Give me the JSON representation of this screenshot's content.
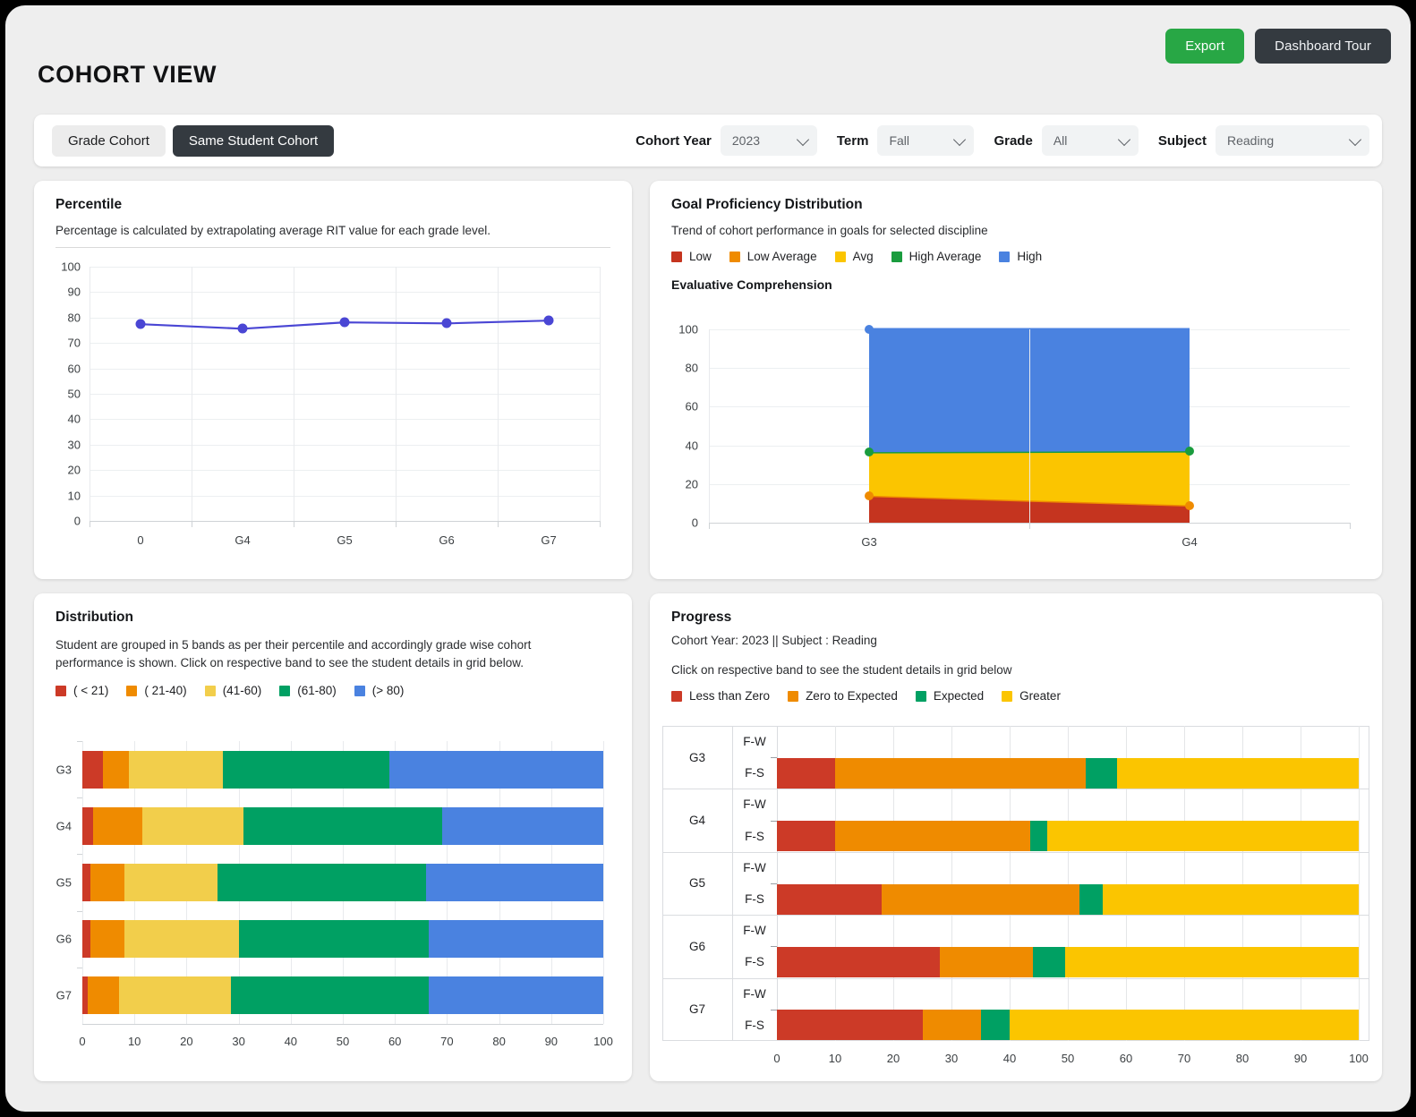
{
  "header": {
    "title": "COHORT VIEW",
    "export_label": "Export",
    "tour_label": "Dashboard Tour",
    "export_color": "#28a745",
    "tour_color": "#343a40"
  },
  "filterbar": {
    "toggle": [
      {
        "label": "Grade Cohort",
        "selected": false
      },
      {
        "label": "Same Student Cohort",
        "selected": true
      }
    ],
    "filters": [
      {
        "label": "Cohort Year",
        "value": "2023"
      },
      {
        "label": "Term",
        "value": "Fall"
      },
      {
        "label": "Grade",
        "value": "All"
      },
      {
        "label": "Subject",
        "value": "Reading"
      }
    ]
  },
  "percentile": {
    "title": "Percentile",
    "subtitle": "Percentage is calculated by extrapolating average RIT value for each grade level."
  },
  "goal": {
    "title": "Goal Proficiency Distribution",
    "subtitle": "Trend of cohort performance in goals for selected discipline",
    "section_title": "Evaluative Comprehension",
    "legend": [
      {
        "label": "Low",
        "color": "#c5341f"
      },
      {
        "label": "Low Average",
        "color": "#ef8b00"
      },
      {
        "label": "Avg",
        "color": "#fbc500"
      },
      {
        "label": "High Average",
        "color": "#1a9c3e"
      },
      {
        "label": "High",
        "color": "#4a82e0"
      }
    ]
  },
  "distribution": {
    "title": "Distribution",
    "subtitle": "Student are grouped in 5 bands as per their percentile and accordingly grade wise cohort performance is shown. Click on respective band to see the student details in grid below.",
    "legend": [
      {
        "label": "( < 21)",
        "color": "#cc3a27"
      },
      {
        "label": "( 21-40)",
        "color": "#ef8b00"
      },
      {
        "label": "(41-60)",
        "color": "#f2ce4b"
      },
      {
        "label": "(61-80)",
        "color": "#00a063"
      },
      {
        "label": "(> 80)",
        "color": "#4a82e0"
      }
    ]
  },
  "progress": {
    "title": "Progress",
    "subtitle": "Cohort Year: 2023 || Subject : Reading",
    "hint": "Click on respective band to see the student details in grid below",
    "legend": [
      {
        "label": "Less than Zero",
        "color": "#cc3a27"
      },
      {
        "label": "Zero to Expected",
        "color": "#ef8b00"
      },
      {
        "label": "Expected",
        "color": "#00a063"
      },
      {
        "label": "Greater",
        "color": "#fbc500"
      }
    ],
    "row_sublabels": [
      "F-W",
      "F-S"
    ]
  },
  "chart_data": [
    {
      "id": "percentile",
      "type": "line",
      "title": "Percentile",
      "xlabel": "",
      "ylabel": "",
      "categories": [
        "0",
        "G4",
        "G5",
        "G6",
        "G7"
      ],
      "series": [
        {
          "name": "Percentile",
          "color": "#4a46d4",
          "values": [
            77.4,
            75.6,
            78.1,
            77.7,
            78.8
          ]
        }
      ],
      "ylim": [
        0,
        100
      ],
      "yticks": [
        0,
        10,
        20,
        30,
        40,
        50,
        60,
        70,
        80,
        90,
        100
      ],
      "grid": true,
      "legend": "none"
    },
    {
      "id": "goal-proficiency",
      "type": "area",
      "title": "Evaluative Comprehension",
      "xlabel": "",
      "ylabel": "",
      "categories": [
        "G3",
        "G4"
      ],
      "series": [
        {
          "name": "Low",
          "color": "#c5341f",
          "values": [
            14.0,
            9.0
          ],
          "cumulative": [
            14.0,
            9.0
          ]
        },
        {
          "name": "Low Average",
          "color": "#ef8b00",
          "values": [
            0.0,
            0.0
          ],
          "cumulative": [
            14.0,
            9.0
          ]
        },
        {
          "name": "Avg",
          "color": "#fbc500",
          "values": [
            22.5,
            28.0
          ],
          "cumulative": [
            36.5,
            37.0
          ]
        },
        {
          "name": "High Average",
          "color": "#1a9c3e",
          "values": [
            0.0,
            0.0
          ],
          "cumulative": [
            36.5,
            37.0
          ]
        },
        {
          "name": "High",
          "color": "#4a82e0",
          "values": [
            63.5,
            63.0
          ],
          "cumulative": [
            100.0,
            100.0
          ]
        }
      ],
      "ylim": [
        0,
        100
      ],
      "yticks": [
        0,
        20,
        40,
        60,
        80,
        100
      ],
      "grid": true,
      "legend": "top"
    },
    {
      "id": "distribution",
      "type": "bar",
      "orientation": "horizontal",
      "stacked": true,
      "title": "Distribution",
      "categories": [
        "G3",
        "G4",
        "G5",
        "G6",
        "G7"
      ],
      "series": [
        {
          "name": "( < 21)",
          "color": "#cc3a27",
          "values": [
            4.0,
            2.0,
            1.5,
            1.5,
            1.0
          ]
        },
        {
          "name": "( 21-40)",
          "color": "#ef8b00",
          "values": [
            5.0,
            9.5,
            6.5,
            6.5,
            6.0
          ]
        },
        {
          "name": "(41-60)",
          "color": "#f2ce4b",
          "values": [
            18.0,
            19.5,
            18.0,
            22.0,
            21.5
          ]
        },
        {
          "name": "(61-80)",
          "color": "#00a063",
          "values": [
            32.0,
            38.0,
            40.0,
            36.5,
            38.0
          ]
        },
        {
          "name": "(> 80)",
          "color": "#4a82e0",
          "values": [
            41.0,
            31.0,
            34.0,
            33.5,
            33.5
          ]
        }
      ],
      "xlim": [
        0,
        100
      ],
      "xticks": [
        0,
        10,
        20,
        30,
        40,
        50,
        60,
        70,
        80,
        90,
        100
      ],
      "grid": true,
      "legend": "top"
    },
    {
      "id": "progress",
      "type": "bar",
      "orientation": "horizontal",
      "stacked": true,
      "title": "Progress",
      "categories": [
        "G3",
        "G4",
        "G5",
        "G6",
        "G7"
      ],
      "subrows": [
        "F-W",
        "F-S"
      ],
      "series": [
        {
          "name": "Less than Zero",
          "color": "#cc3a27",
          "values": [
            10.0,
            10.0,
            18.0,
            28.0,
            25.0
          ]
        },
        {
          "name": "Zero to Expected",
          "color": "#ef8b00",
          "values": [
            43.0,
            33.5,
            34.0,
            16.0,
            10.0
          ]
        },
        {
          "name": "Expected",
          "color": "#00a063",
          "values": [
            5.5,
            3.0,
            4.0,
            5.5,
            5.0
          ]
        },
        {
          "name": "Greater",
          "color": "#fbc500",
          "values": [
            41.5,
            53.5,
            44.0,
            50.5,
            60.0
          ]
        }
      ],
      "xlim": [
        0,
        100
      ],
      "xticks": [
        0,
        10,
        20,
        30,
        40,
        50,
        60,
        70,
        80,
        90,
        100
      ],
      "grid": true,
      "legend": "top"
    }
  ]
}
